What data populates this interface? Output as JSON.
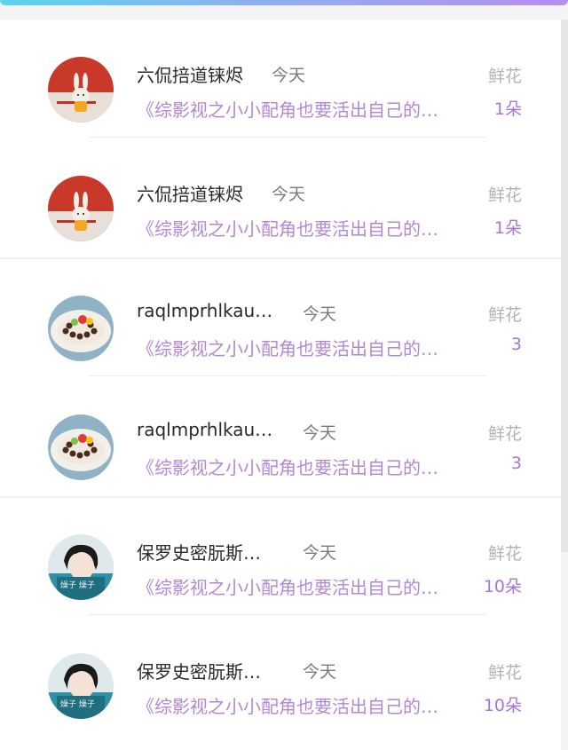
{
  "list": {
    "items": [
      {
        "name": "六侃掊道铼烬",
        "time": "今天",
        "book": "《综影视之小小配角也要活出自己的…",
        "gift": "鲜花",
        "count": "1朵",
        "avatar": "rabbit-avatar"
      },
      {
        "name": "六侃掊道铼烬",
        "time": "今天",
        "book": "《综影视之小小配角也要活出自己的…",
        "gift": "鲜花",
        "count": "1朵",
        "avatar": "rabbit-avatar"
      },
      {
        "name": "raqlmprhlkau…",
        "time": "今天",
        "book": "《综影视之小小配角也要活出自己的…",
        "gift": "鲜花",
        "count": "3",
        "avatar": "dessert-avatar"
      },
      {
        "name": "raqlmprhlkau…",
        "time": "今天",
        "book": "《综影视之小小配角也要活出自己的…",
        "gift": "鲜花",
        "count": "3",
        "avatar": "dessert-avatar"
      },
      {
        "name": "保罗史密朊斯…",
        "time": "今天",
        "book": "《综影视之小小配角也要活出自己的…",
        "gift": "鲜花",
        "count": "10朵",
        "avatar": "person-avatar"
      },
      {
        "name": "保罗史密朊斯…",
        "time": "今天",
        "book": "《综影视之小小配角也要活出自己的…",
        "gift": "鲜花",
        "count": "10朵",
        "avatar": "person-avatar"
      }
    ]
  }
}
